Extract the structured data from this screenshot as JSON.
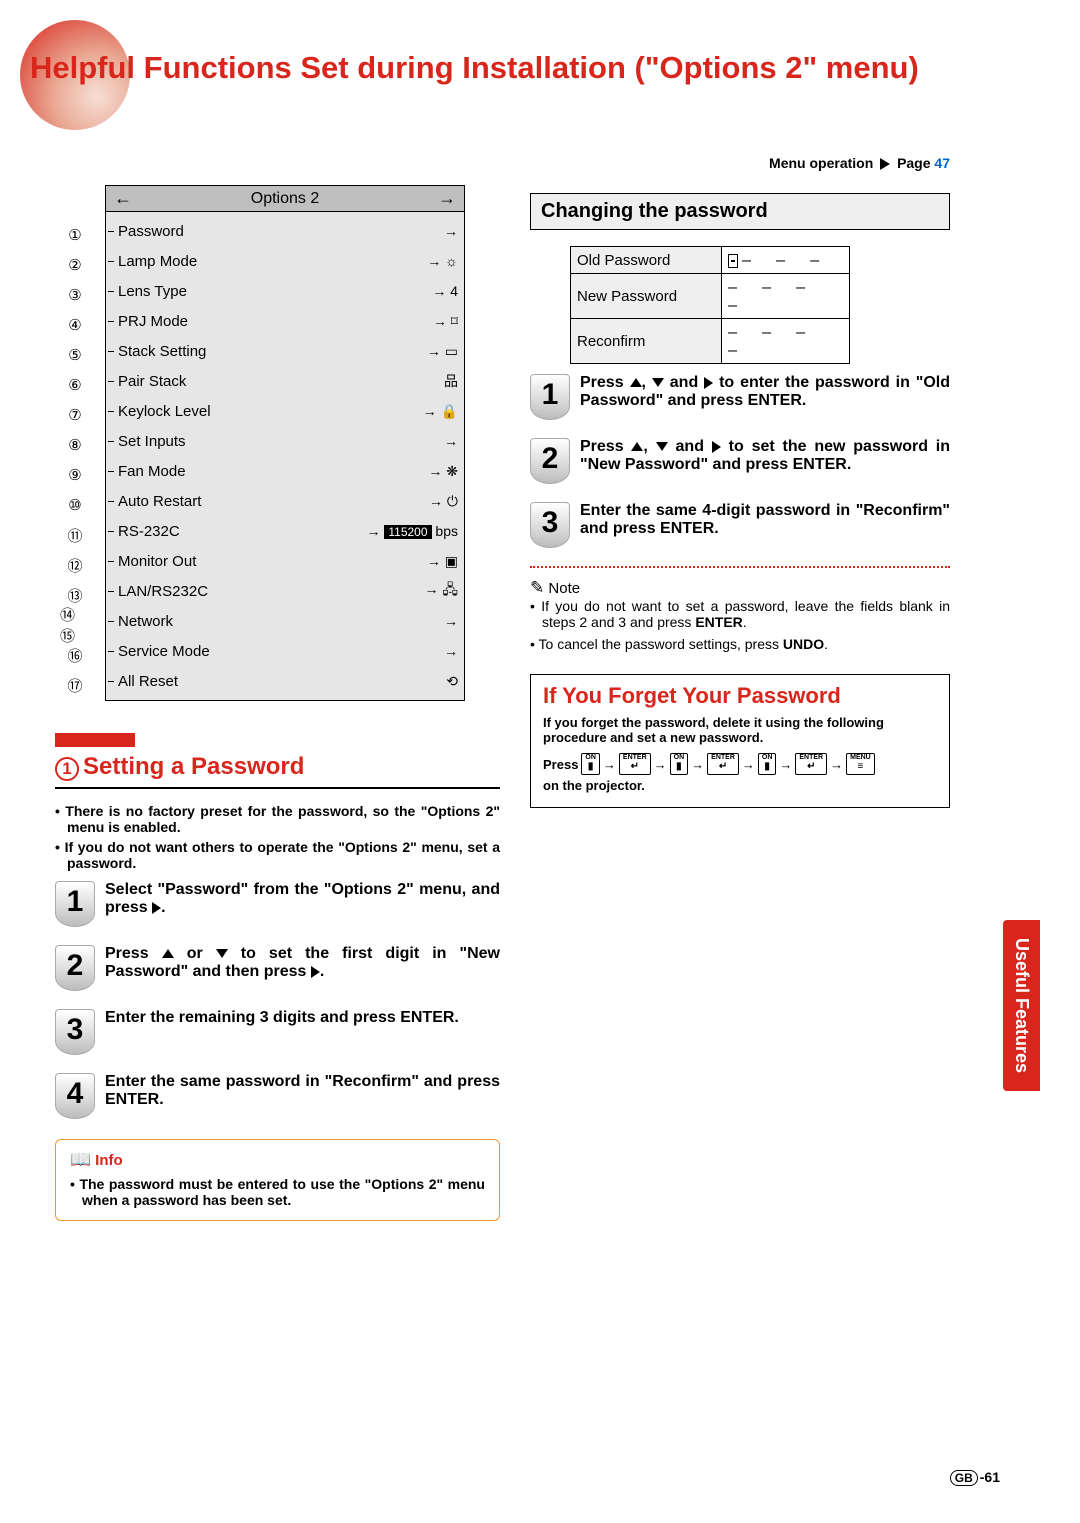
{
  "title": "Helpful Functions Set during Installation (\"Options 2\" menu)",
  "menu_operation": {
    "label": "Menu operation",
    "page_label": "Page",
    "page": "47"
  },
  "osd_menu": {
    "header": "Options 2",
    "items": [
      {
        "n": "①",
        "label": "Password",
        "icon": "→"
      },
      {
        "n": "②",
        "label": "Lamp Mode",
        "icon": "→ ☼"
      },
      {
        "n": "③",
        "label": "Lens Type",
        "icon": "→ 4",
        "boxed": true
      },
      {
        "n": "④",
        "label": "PRJ Mode",
        "icon": "→ ⌑"
      },
      {
        "n": "⑤",
        "label": "Stack Setting",
        "icon": "→ ▭"
      },
      {
        "n": "⑥",
        "label": "Pair Stack",
        "icon": "品"
      },
      {
        "n": "⑦",
        "label": "Keylock Level",
        "icon": "→ 🔒"
      },
      {
        "n": "⑧",
        "label": "Set Inputs",
        "icon": "→"
      },
      {
        "n": "⑨",
        "label": "Fan Mode",
        "icon": "→ ❋"
      },
      {
        "n": "⑩",
        "label": "Auto Restart",
        "icon": "→ ⏻"
      },
      {
        "n": "⑪",
        "label": "RS-232C",
        "icon": "→",
        "extra": "115200",
        "unit": "bps"
      },
      {
        "n": "⑫",
        "label": "Monitor Out",
        "icon": "→ ▣"
      },
      {
        "n": "⑬",
        "label": "LAN/RS232C",
        "icon": "→ 🖧"
      },
      {
        "n": "⑭ ⑮",
        "label": "Network",
        "icon": "→"
      },
      {
        "n": "⑯",
        "label": "Service Mode",
        "icon": "→"
      },
      {
        "n": "⑰",
        "label": "All Reset",
        "icon": "⟲"
      }
    ]
  },
  "section1": {
    "heading": "Setting a Password",
    "number": "1",
    "bullets": [
      "There is no factory preset for the password, so the \"Options 2\" menu is enabled.",
      "If you do not want others to operate the \"Options 2\" menu, set a password."
    ],
    "steps": [
      "Select \"Password\" from the \"Options 2\" menu, and press ▶.",
      "Press ▲ or ▼ to set the first digit in \"New Password\" and then press ▶.",
      "Enter the remaining 3 digits and press ENTER.",
      "Enter the same password in \"Reconfirm\" and press ENTER."
    ],
    "info": {
      "title": "Info",
      "text": "The password must be entered to use the \"Options 2\" menu when a password has been set."
    }
  },
  "section2": {
    "heading": "Changing the password",
    "pw_rows": [
      {
        "label": "Old Password",
        "val": "– – – –",
        "cursor": true
      },
      {
        "label": "New Password",
        "val": "– – – –"
      },
      {
        "label": "Reconfirm",
        "val": "– – – –"
      }
    ],
    "steps": [
      "Press ▲, ▼ and ▶ to enter the password in \"Old Password\" and press ENTER.",
      "Press ▲, ▼ and ▶ to set the new password in \"New Password\" and press ENTER.",
      "Enter the same 4-digit password in \"Reconfirm\" and press ENTER."
    ],
    "note": {
      "title": "Note",
      "items": [
        "If you do not want to set a password, leave the fields blank in steps 2 and 3 and press ENTER.",
        "To cancel the password settings, press UNDO."
      ]
    }
  },
  "forget": {
    "heading": "If You Forget Your Password",
    "intro": "If you forget the password, delete it using the following procedure and set a new password.",
    "press": "Press",
    "suffix": "on the projector.",
    "seq": [
      "ON",
      "ENTER",
      "ON",
      "ENTER",
      "ON",
      "ENTER",
      "MENU"
    ]
  },
  "side_tab": "Useful Features",
  "pageno": {
    "prefix": "GB",
    "num": "-61"
  }
}
